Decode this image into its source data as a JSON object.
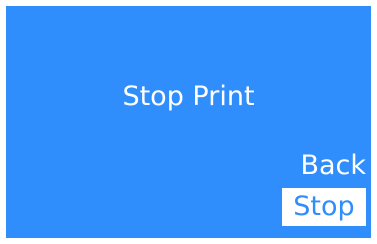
{
  "screen": {
    "background_color": "#2f8dfc",
    "title": "Stop Print"
  },
  "menu": {
    "back_label": "Back",
    "stop_label": "Stop",
    "selected_item": "Stop",
    "selected_bg_color": "#ffffff"
  }
}
